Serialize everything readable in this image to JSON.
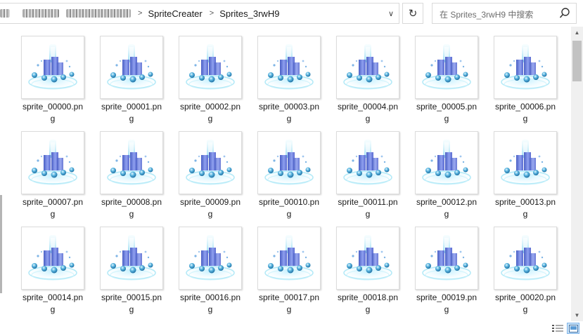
{
  "address": {
    "crumbs": [
      "SpriteCreater",
      "Sprites_3rwH9"
    ],
    "separator": ">",
    "dropdown_icon": "chevron-down-icon",
    "refresh_icon": "refresh-icon"
  },
  "search": {
    "placeholder": "在 Sprites_3rwH9 中搜索",
    "icon": "search-icon"
  },
  "files": [
    {
      "line1": "sprite_00000.pn",
      "line2": "g"
    },
    {
      "line1": "sprite_00001.pn",
      "line2": "g"
    },
    {
      "line1": "sprite_00002.pn",
      "line2": "g"
    },
    {
      "line1": "sprite_00003.pn",
      "line2": "g"
    },
    {
      "line1": "sprite_00004.pn",
      "line2": "g"
    },
    {
      "line1": "sprite_00005.pn",
      "line2": "g"
    },
    {
      "line1": "sprite_00006.pn",
      "line2": "g"
    },
    {
      "line1": "sprite_00007.pn",
      "line2": "g"
    },
    {
      "line1": "sprite_00008.pn",
      "line2": "g"
    },
    {
      "line1": "sprite_00009.pn",
      "line2": "g"
    },
    {
      "line1": "sprite_00010.pn",
      "line2": "g"
    },
    {
      "line1": "sprite_00011.pn",
      "line2": "g"
    },
    {
      "line1": "sprite_00012.pn",
      "line2": "g"
    },
    {
      "line1": "sprite_00013.pn",
      "line2": "g"
    },
    {
      "line1": "sprite_00014.pn",
      "line2": "g"
    },
    {
      "line1": "sprite_00015.pn",
      "line2": "g"
    },
    {
      "line1": "sprite_00016.pn",
      "line2": "g"
    },
    {
      "line1": "sprite_00017.pn",
      "line2": "g"
    },
    {
      "line1": "sprite_00018.pn",
      "line2": "g"
    },
    {
      "line1": "sprite_00019.pn",
      "line2": "g"
    },
    {
      "line1": "sprite_00020.pn",
      "line2": "g"
    }
  ],
  "statusbar": {
    "details_view_icon": "details-view-icon",
    "large_icons_view_icon": "large-icons-view-icon"
  },
  "colors": {
    "accent": "#cce4f7",
    "sprite_blue": "#6f7fd6",
    "sprite_cyan": "#7fd3ef"
  }
}
